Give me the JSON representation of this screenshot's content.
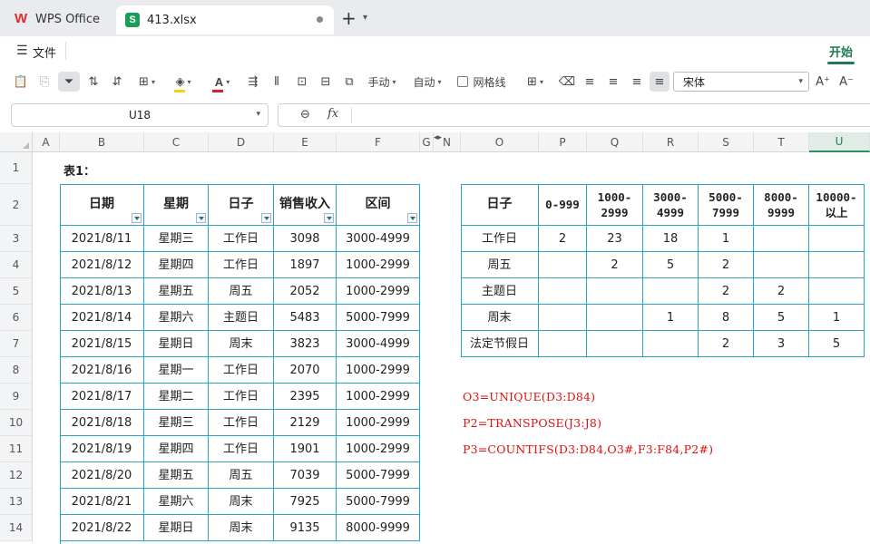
{
  "tabs": {
    "home_label": "WPS Office",
    "file_label": "413.xlsx",
    "file_icon_letter": "S"
  },
  "menu": {
    "file": "文件",
    "start": "开始"
  },
  "toolbar": {
    "manual": "手动",
    "auto": "自动",
    "gridlines": "网格线",
    "font": "宋体"
  },
  "formula_bar": {
    "cell_ref": "U18",
    "fx": "fx",
    "content": ""
  },
  "columns": [
    "A",
    "B",
    "C",
    "D",
    "E",
    "F",
    "G",
    "N",
    "O",
    "P",
    "Q",
    "R",
    "S",
    "T",
    "U"
  ],
  "rows": [
    "1",
    "2",
    "3",
    "4",
    "5",
    "6",
    "7",
    "8",
    "9",
    "10",
    "11",
    "12",
    "13",
    "14"
  ],
  "sheet": {
    "title": "表1：",
    "left_headers": [
      "日期",
      "星期",
      "日子",
      "销售收入",
      "区间"
    ],
    "left_rows": [
      [
        "2021/8/11",
        "星期三",
        "工作日",
        "3098",
        "3000-4999"
      ],
      [
        "2021/8/12",
        "星期四",
        "工作日",
        "1897",
        "1000-2999"
      ],
      [
        "2021/8/13",
        "星期五",
        "周五",
        "2052",
        "1000-2999"
      ],
      [
        "2021/8/14",
        "星期六",
        "主题日",
        "5483",
        "5000-7999"
      ],
      [
        "2021/8/15",
        "星期日",
        "周末",
        "3823",
        "3000-4999"
      ],
      [
        "2021/8/16",
        "星期一",
        "工作日",
        "2070",
        "1000-2999"
      ],
      [
        "2021/8/17",
        "星期二",
        "工作日",
        "2395",
        "1000-2999"
      ],
      [
        "2021/8/18",
        "星期三",
        "工作日",
        "2129",
        "1000-2999"
      ],
      [
        "2021/8/19",
        "星期四",
        "工作日",
        "1901",
        "1000-2999"
      ],
      [
        "2021/8/20",
        "星期五",
        "周五",
        "7039",
        "5000-7999"
      ],
      [
        "2021/8/21",
        "星期六",
        "周末",
        "7925",
        "5000-7999"
      ],
      [
        "2021/8/22",
        "星期日",
        "周末",
        "9135",
        "8000-9999"
      ]
    ],
    "right_headers": [
      "日子",
      "0-999",
      "1000-\n2999",
      "3000-\n4999",
      "5000-\n7999",
      "8000-\n9999",
      "10000-\n以上"
    ],
    "right_rows": [
      [
        "工作日",
        "2",
        "23",
        "18",
        "1",
        "",
        ""
      ],
      [
        "周五",
        "",
        "2",
        "5",
        "2",
        "",
        ""
      ],
      [
        "主题日",
        "",
        "",
        "",
        "2",
        "2",
        ""
      ],
      [
        "周末",
        "",
        "",
        "1",
        "8",
        "5",
        "1"
      ],
      [
        "法定节假日",
        "",
        "",
        "",
        "2",
        "3",
        "5"
      ]
    ],
    "formulas": [
      "O3=UNIQUE(D3:D84)",
      "P2=TRANSPOSE(J3:J8)",
      "P3=COUNTIFS(D3:D84,O3#,F3:F84,P2#)"
    ]
  },
  "colors": {
    "accent": "#1f7a52",
    "table_border": "#2aa3c6",
    "formula_red": "#e01010"
  }
}
